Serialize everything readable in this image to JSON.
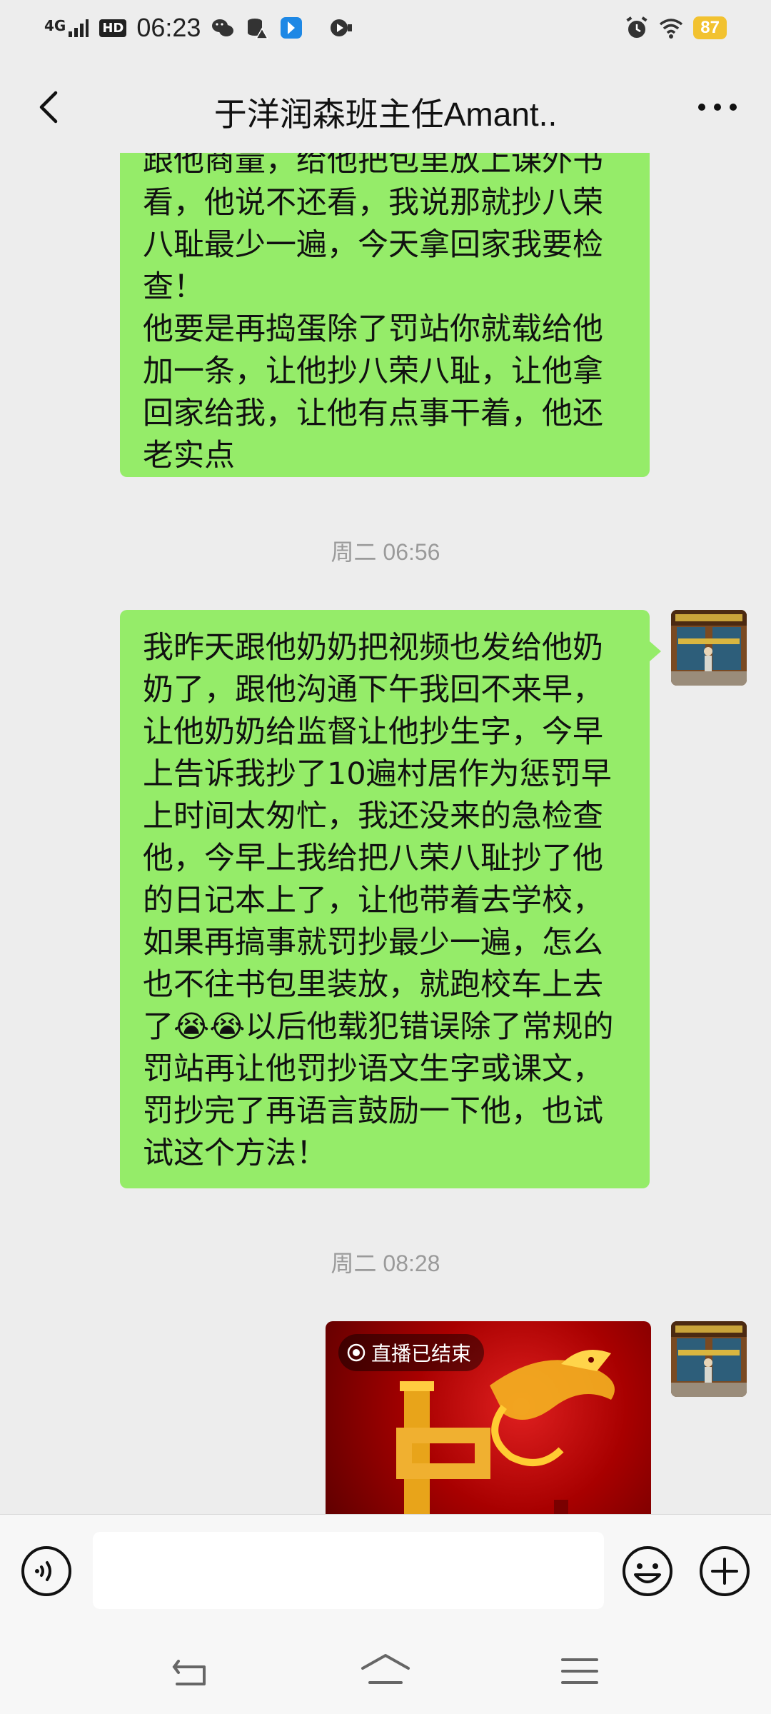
{
  "status_bar": {
    "network": "4G",
    "hd": "HD",
    "time": "06:23",
    "battery": "87"
  },
  "header": {
    "title": "于洋润森班主任Amant.."
  },
  "messages": [
    {
      "type": "text",
      "side": "right",
      "text": "跟他商量，给他把包里放上课外书看，他说不还看，我说那就抄八荣八耻最少一遍，今天拿回家我要检查！\n他要是再捣蛋除了罚站你就载给他加一条，让他抄八荣八耻，让他拿回家给我，让他有点事干着，他还老实点"
    },
    {
      "type": "timestamp",
      "text": "周二 06:56"
    },
    {
      "type": "text",
      "side": "right",
      "text": "我昨天跟他奶奶把视频也发给他奶奶了，跟他沟通下午我回不来早，让他奶奶给监督让他抄生字，今早上告诉我抄了10遍村居作为惩罚早上时间太匆忙，我还没来的急检查他，今早上我给把八荣八耻抄了他的日记本上了，让他带着去学校，如果再搞事就罚抄最少一遍，怎么也不往书包里装放，就跑校车上去了😭😭以后他载犯错误除了常规的罚站再让他罚抄语文生字或课文，罚抄完了再语言鼓励一下他，也试试这个方法！"
    },
    {
      "type": "timestamp",
      "text": "周二 08:28"
    },
    {
      "type": "live",
      "side": "right",
      "badge": "直播已结束"
    }
  ],
  "input_bar": {
    "placeholder": ""
  },
  "colors": {
    "bubble": "#95EC69",
    "background": "#EDEDED",
    "battery": "#F2C230"
  }
}
